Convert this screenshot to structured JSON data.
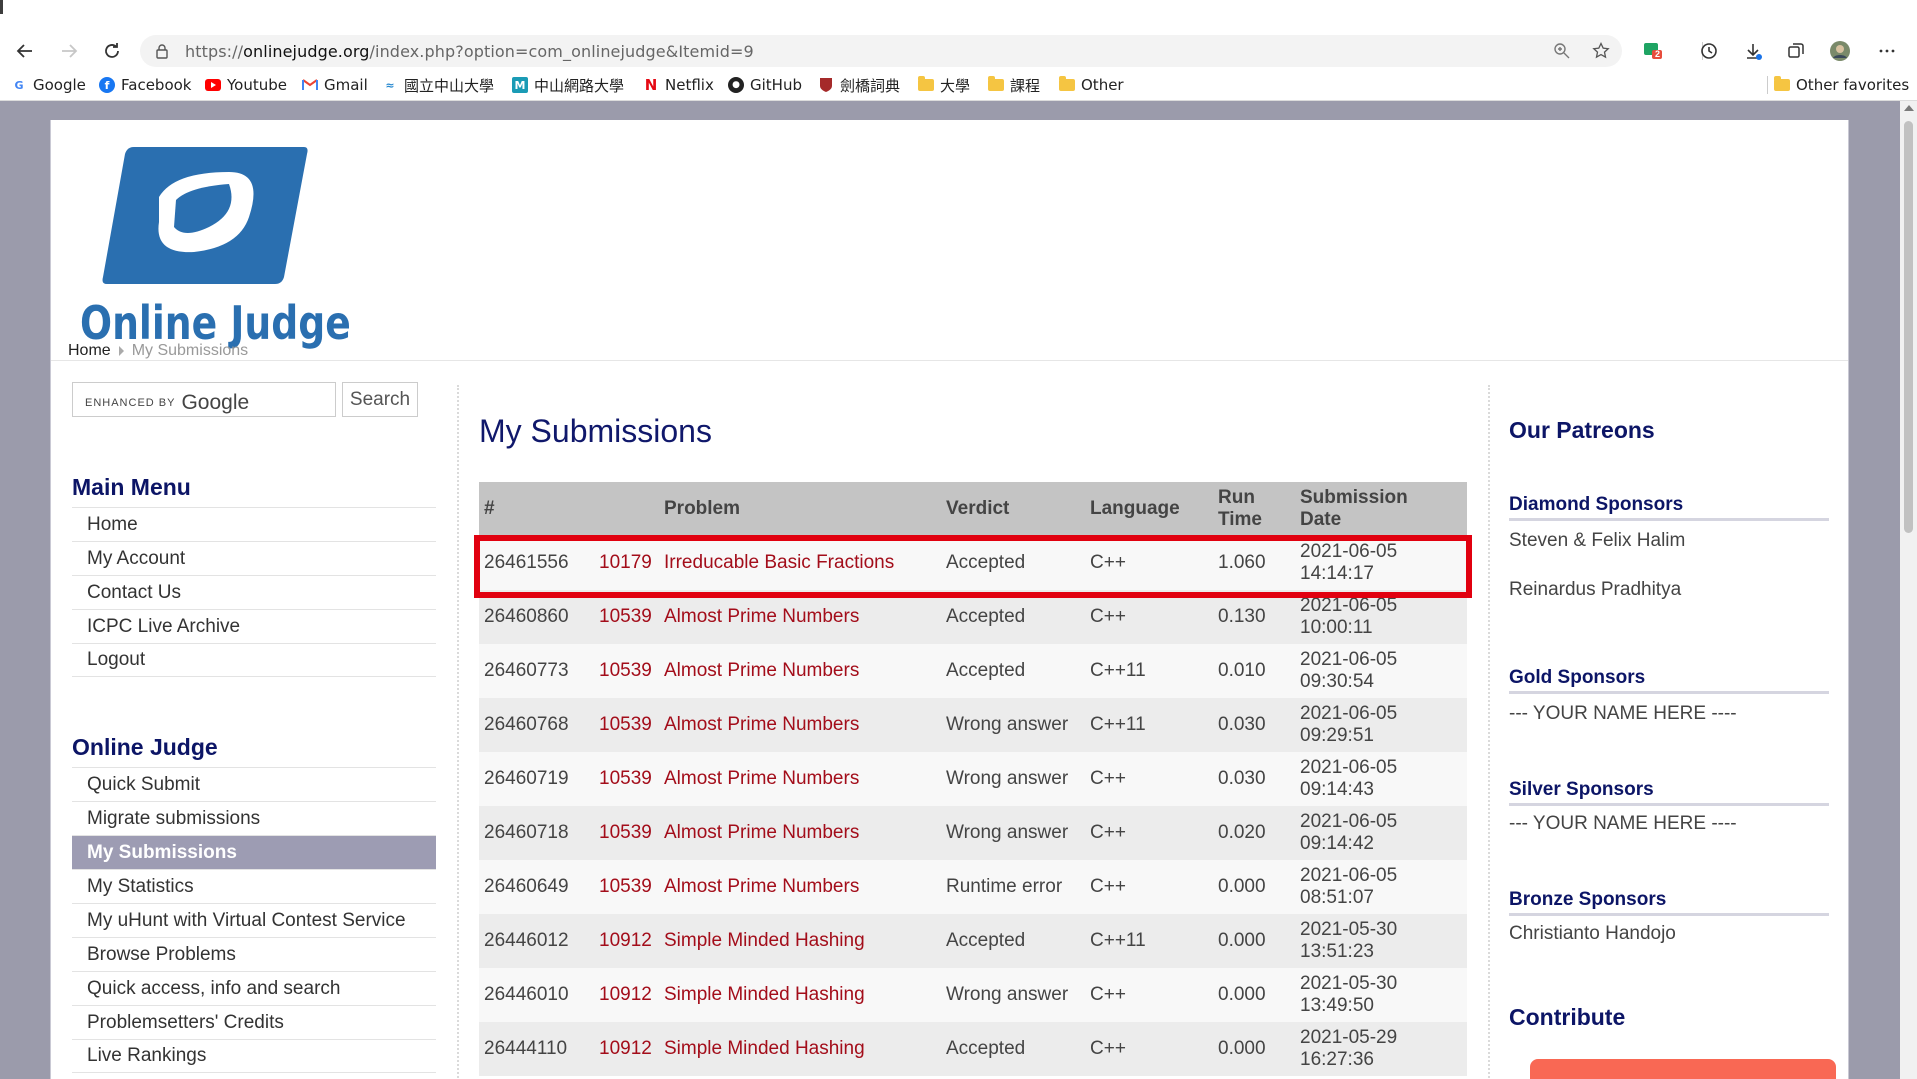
{
  "browser": {
    "url_prefix": "https://",
    "url_domain": "onlinejudge.org",
    "url_path": "/index.php?option=com_onlinejudge&Itemid=9",
    "extension_badge": "2",
    "bookmarks": [
      {
        "label": "Google",
        "icon": "google-icon"
      },
      {
        "label": "Facebook",
        "icon": "facebook-icon"
      },
      {
        "label": "Youtube",
        "icon": "youtube-icon"
      },
      {
        "label": "Gmail",
        "icon": "gmail-icon"
      },
      {
        "label": "國立中山大學",
        "icon": "nsysu-icon"
      },
      {
        "label": "中山網路大學",
        "icon": "cyber-univ-icon"
      },
      {
        "label": "Netflix",
        "icon": "netflix-icon"
      },
      {
        "label": "GitHub",
        "icon": "github-icon"
      },
      {
        "label": "劍橋詞典",
        "icon": "cambridge-icon"
      },
      {
        "label": "大學",
        "icon": "folder-icon"
      },
      {
        "label": "課程",
        "icon": "folder-icon"
      },
      {
        "label": "Other",
        "icon": "folder-icon"
      }
    ],
    "other_favorites": "Other favorites"
  },
  "site": {
    "logo_text": "Online Judge",
    "breadcrumb": {
      "home": "Home",
      "current": "My Submissions"
    },
    "search": {
      "enhanced_by": "ENHANCED BY",
      "google": "Google",
      "button": "Search"
    }
  },
  "sidebar": {
    "main_menu_title": "Main Menu",
    "main_menu": [
      "Home",
      "My Account",
      "Contact Us",
      "ICPC Live Archive",
      "Logout"
    ],
    "oj_title": "Online Judge",
    "oj_menu": [
      "Quick Submit",
      "Migrate submissions",
      "My Submissions",
      "My Statistics",
      "My uHunt with Virtual Contest Service",
      "Browse Problems",
      "Quick access, info and search",
      "Problemsetters' Credits",
      "Live Rankings"
    ],
    "active_item": "My Submissions"
  },
  "main": {
    "title": "My Submissions",
    "columns": [
      "#",
      "Problem",
      "Verdict",
      "Language",
      "Run Time",
      "Submission Date"
    ],
    "rows": [
      {
        "id": "26461556",
        "pid": "10179",
        "name": "Irreducable Basic Fractions",
        "verdict": "Accepted",
        "lang": "C++",
        "time": "1.060",
        "date": "2021-06-05",
        "clock": "14:14:17"
      },
      {
        "id": "26460860",
        "pid": "10539",
        "name": "Almost Prime Numbers",
        "verdict": "Accepted",
        "lang": "C++",
        "time": "0.130",
        "date": "2021-06-05",
        "clock": "10:00:11"
      },
      {
        "id": "26460773",
        "pid": "10539",
        "name": "Almost Prime Numbers",
        "verdict": "Accepted",
        "lang": "C++11",
        "time": "0.010",
        "date": "2021-06-05",
        "clock": "09:30:54"
      },
      {
        "id": "26460768",
        "pid": "10539",
        "name": "Almost Prime Numbers",
        "verdict": "Wrong answer",
        "lang": "C++11",
        "time": "0.030",
        "date": "2021-06-05",
        "clock": "09:29:51"
      },
      {
        "id": "26460719",
        "pid": "10539",
        "name": "Almost Prime Numbers",
        "verdict": "Wrong answer",
        "lang": "C++",
        "time": "0.030",
        "date": "2021-06-05",
        "clock": "09:14:43"
      },
      {
        "id": "26460718",
        "pid": "10539",
        "name": "Almost Prime Numbers",
        "verdict": "Wrong answer",
        "lang": "C++",
        "time": "0.020",
        "date": "2021-06-05",
        "clock": "09:14:42"
      },
      {
        "id": "26460649",
        "pid": "10539",
        "name": "Almost Prime Numbers",
        "verdict": "Runtime error",
        "lang": "C++",
        "time": "0.000",
        "date": "2021-06-05",
        "clock": "08:51:07"
      },
      {
        "id": "26446012",
        "pid": "10912",
        "name": "Simple Minded Hashing",
        "verdict": "Accepted",
        "lang": "C++11",
        "time": "0.000",
        "date": "2021-05-30",
        "clock": "13:51:23"
      },
      {
        "id": "26446010",
        "pid": "10912",
        "name": "Simple Minded Hashing",
        "verdict": "Wrong answer",
        "lang": "C++",
        "time": "0.000",
        "date": "2021-05-30",
        "clock": "13:49:50"
      },
      {
        "id": "26444110",
        "pid": "10912",
        "name": "Simple Minded Hashing",
        "verdict": "Accepted",
        "lang": "C++",
        "time": "0.000",
        "date": "2021-05-29",
        "clock": "16:27:36"
      }
    ],
    "highlighted_row": 0
  },
  "right": {
    "title": "Our Patreons",
    "diamond": {
      "title": "Diamond Sponsors",
      "names": [
        "Steven & Felix Halim",
        "Reinardus Pradhitya"
      ]
    },
    "gold": {
      "title": "Gold Sponsors",
      "names": [
        "--- YOUR NAME HERE ----"
      ]
    },
    "silver": {
      "title": "Silver Sponsors",
      "names": [
        "--- YOUR NAME HERE ----"
      ]
    },
    "bronze": {
      "title": "Bronze Sponsors",
      "names": [
        "Christianto Handojo"
      ]
    },
    "contribute": "Contribute"
  },
  "colors": {
    "link_red": "#a30d1a",
    "heading_navy": "#0c1566",
    "highlight_frame": "#e1000f",
    "active_menu_bg": "#9d9cb3",
    "donate_orange": "#f96854"
  }
}
